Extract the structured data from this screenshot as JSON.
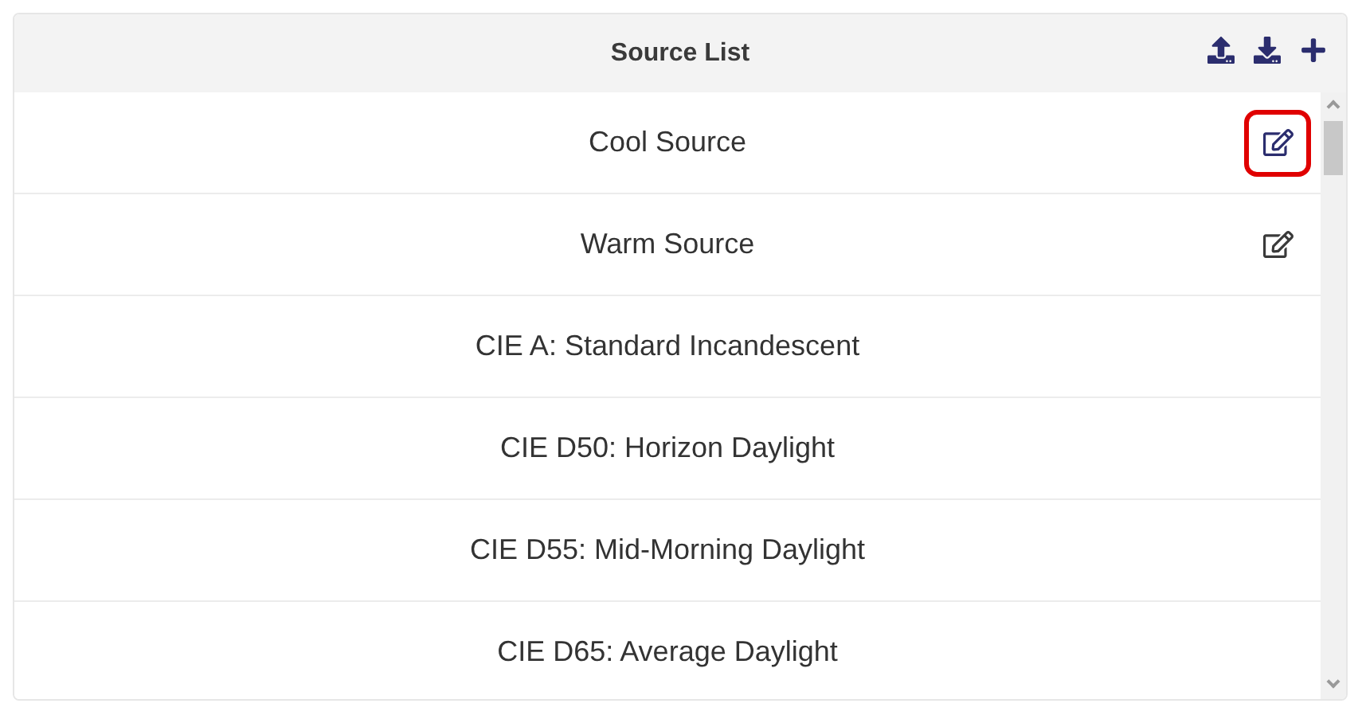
{
  "header": {
    "title": "Source List"
  },
  "rows": [
    {
      "label": "Cool Source",
      "edit": {
        "highlighted": true
      }
    },
    {
      "label": "Warm Source",
      "edit": {
        "highlighted": false
      }
    },
    {
      "label": "CIE A: Standard Incandescent"
    },
    {
      "label": "CIE D50: Horizon Daylight"
    },
    {
      "label": "CIE D55: Mid-Morning Daylight"
    },
    {
      "label": "CIE D65: Average Daylight"
    }
  ]
}
